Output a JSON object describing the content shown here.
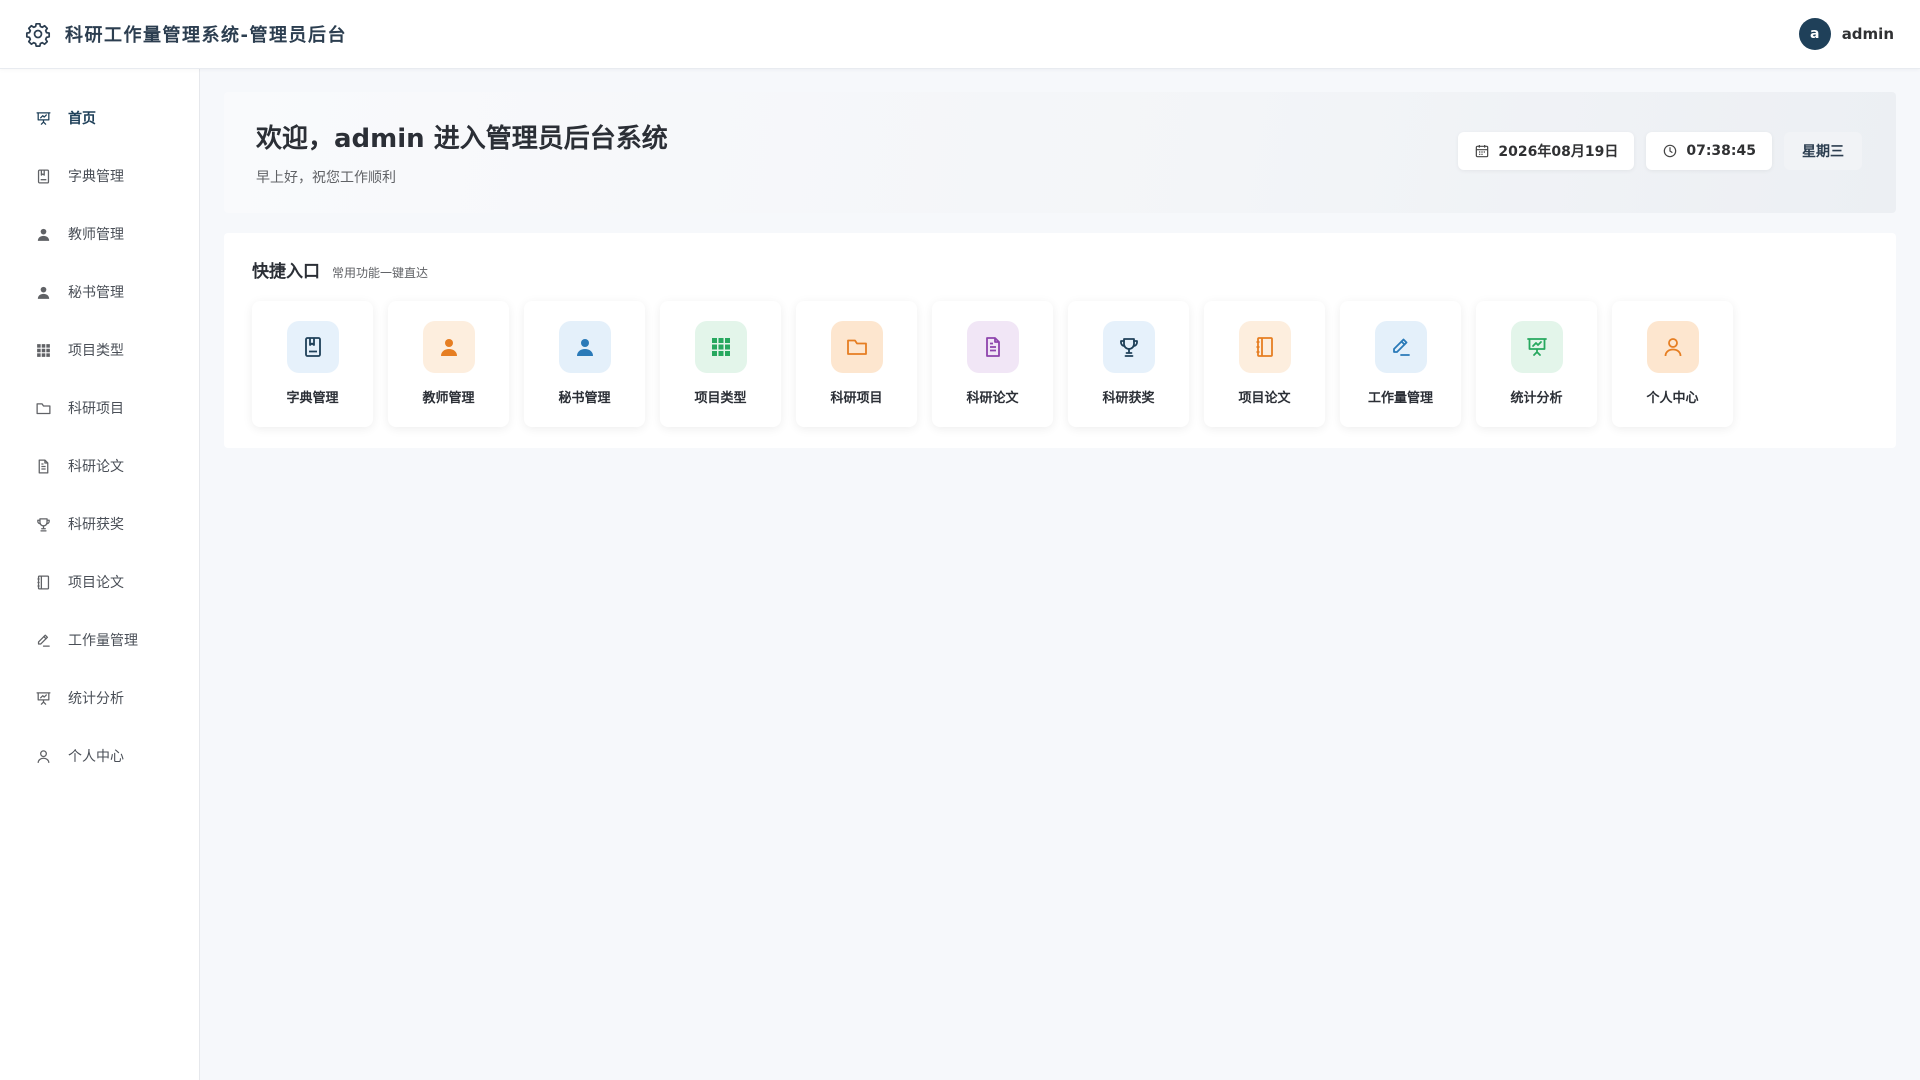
{
  "header": {
    "title": "科研工作量管理系统-管理员后台",
    "icon": "gear-icon"
  },
  "user": {
    "avatar_letter": "a",
    "name": "admin"
  },
  "sidebar": {
    "items": [
      {
        "label": "首页",
        "icon": "presentation-chart-icon",
        "active": true
      },
      {
        "label": "字典管理",
        "icon": "book-icon"
      },
      {
        "label": "教师管理",
        "icon": "user-solid-icon"
      },
      {
        "label": "秘书管理",
        "icon": "user-solid-icon"
      },
      {
        "label": "项目类型",
        "icon": "grid-icon"
      },
      {
        "label": "科研项目",
        "icon": "folder-icon"
      },
      {
        "label": "科研论文",
        "icon": "document-icon"
      },
      {
        "label": "科研获奖",
        "icon": "trophy-icon"
      },
      {
        "label": "项目论文",
        "icon": "notebook-icon"
      },
      {
        "label": "工作量管理",
        "icon": "edit-pen-icon"
      },
      {
        "label": "统计分析",
        "icon": "presentation-chart-icon"
      },
      {
        "label": "个人中心",
        "icon": "user-outline-icon"
      }
    ]
  },
  "welcome": {
    "title": "欢迎，admin 进入管理员后台系统",
    "subtitle": "早上好，祝您工作顺利",
    "date": "2026年08月19日",
    "time": "07:38:45",
    "weekday": "星期三"
  },
  "quick": {
    "title": "快捷入口",
    "subtitle": "常用功能一键直达",
    "cards": [
      {
        "label": "字典管理",
        "icon": "book-icon",
        "color": "#1f4059",
        "bg": "#e6f1fb"
      },
      {
        "label": "教师管理",
        "icon": "user-solid-icon",
        "color": "#e67e22",
        "bg": "#fdeede"
      },
      {
        "label": "秘书管理",
        "icon": "user-solid-icon",
        "color": "#2a7ab8",
        "bg": "#e4f0fa"
      },
      {
        "label": "项目类型",
        "icon": "grid-icon",
        "color": "#27a85f",
        "bg": "#e3f5ea"
      },
      {
        "label": "科研项目",
        "icon": "folder-icon",
        "color": "#e67e22",
        "bg": "#fde6cf"
      },
      {
        "label": "科研论文",
        "icon": "document-icon",
        "color": "#8e44ad",
        "bg": "#f1e6f6"
      },
      {
        "label": "科研获奖",
        "icon": "trophy-icon",
        "color": "#1f4059",
        "bg": "#e6f1fb"
      },
      {
        "label": "项目论文",
        "icon": "notebook-icon",
        "color": "#e67e22",
        "bg": "#fdeede"
      },
      {
        "label": "工作量管理",
        "icon": "edit-pen-icon",
        "color": "#2a7ab8",
        "bg": "#e4f0fa"
      },
      {
        "label": "统计分析",
        "icon": "presentation-chart-icon",
        "color": "#27a85f",
        "bg": "#e3f5ea"
      },
      {
        "label": "个人中心",
        "icon": "user-outline-icon",
        "color": "#e67e22",
        "bg": "#fde6cf"
      }
    ]
  }
}
